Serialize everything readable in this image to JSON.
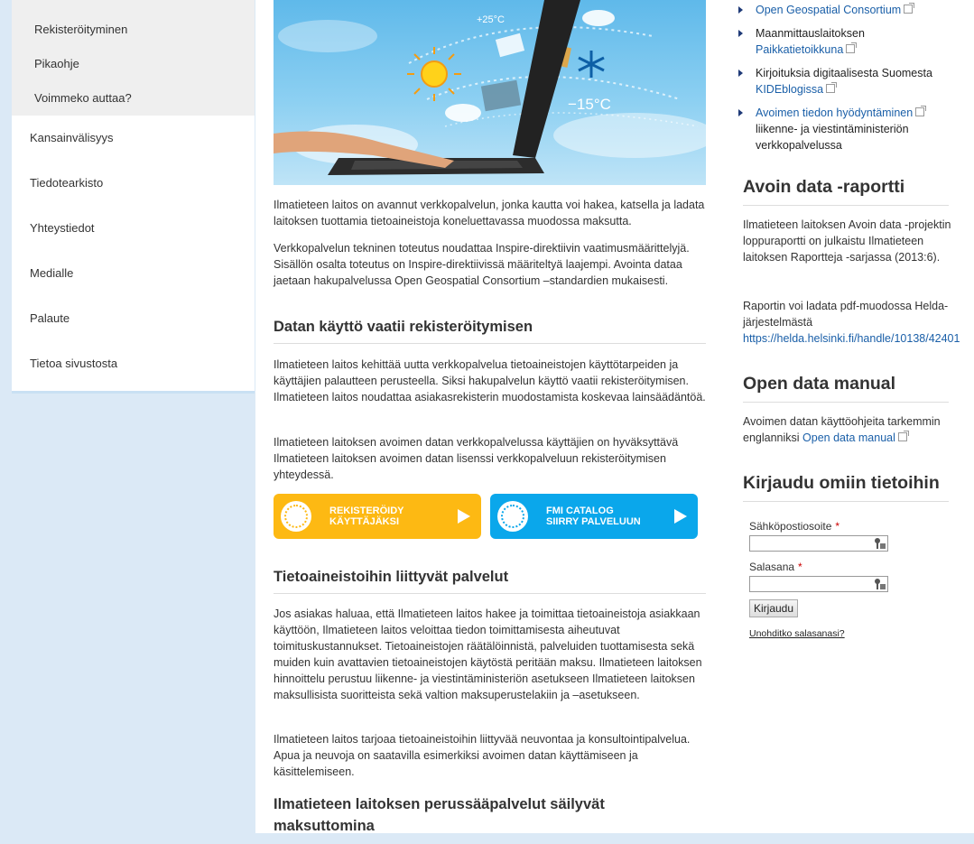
{
  "left_nav": {
    "sub_items": [
      "Rekisteröityminen",
      "Pikaohje",
      "Voimmeko auttaa?"
    ],
    "main_items": [
      "Kansainvälisyys",
      "Tiedotearkisto",
      "Yhteystiedot",
      "Medialle",
      "Palaute",
      "Tietoa sivustosta"
    ]
  },
  "hero": {
    "temp_warm": "+25°C",
    "temp_cold": "−15°C"
  },
  "center": {
    "intro_p1": "Ilmatieteen laitos on avannut verkkopalvelun, jonka kautta voi hakea, katsella ja ladata laitoksen tuottamia tietoaineistoja koneluettavassa muodossa maksutta.",
    "intro_p2": "Verkkopalvelun tekninen toteutus noudattaa Inspire-direktiivin vaatimusmäärittelyjä. Sisällön osalta toteutus on Inspire-direktiivissä määriteltyä laajempi. Avointa dataa jaetaan hakupalvelussa Open Geospatial Consortium –standardien mukaisesti.",
    "h_registration": "Datan käyttö vaatii rekisteröitymisen",
    "reg_p1": "Ilmatieteen laitos kehittää uutta verkkopalvelua tietoaineistojen käyttötarpeiden ja käyttäjien palautteen perusteella. Siksi hakupalvelun käyttö vaatii rekisteröitymisen. Ilmatieteen laitos noudattaa asiakasrekisterin muodostamista koskevaa lainsäädäntöä.",
    "reg_p2": "Ilmatieteen laitoksen avoimen datan verkkopalvelussa käyttäjien on hyväksyttävä Ilmatieteen laitoksen avoimen datan lisenssi verkkopalveluun rekisteröitymisen yhteydessä.",
    "cta_register_line1": "REKISTERÖIDY",
    "cta_register_line2": "KÄYTTÄJÄKSI",
    "cta_catalog_line1": "FMI CATALOG",
    "cta_catalog_line2": "SIIRRY PALVELUUN",
    "h_services": "Tietoaineistoihin liittyvät palvelut",
    "services_p1": "Jos asiakas haluaa, että Ilmatieteen laitos hakee ja toimittaa tietoaineistoja asiakkaan käyttöön, Ilmatieteen laitos veloittaa tiedon toimittamisesta aiheutuvat toimituskustannukset. Tietoaineistojen räätälöinnistä, palveluiden tuottamisesta sekä muiden kuin avattavien tietoaineistojen käytöstä peritään maksu.  Ilmatieteen laitoksen hinnoittelu perustuu liikenne- ja viestintäministeriön asetukseen Ilmatieteen laitoksen maksullisista suoritteista sekä valtion maksuperustelakiin ja –asetukseen.",
    "services_p2": "Ilmatieteen laitos tarjoaa tietoaineistoihin liittyvää neuvontaa ja konsultointipalvelua. Apua ja neuvoja on saatavilla esimerkiksi avoimen datan käyttämiseen ja käsittelemiseen.",
    "h_basic": "Ilmatieteen laitoksen perussääpalvelut säilyvät maksuttomina"
  },
  "right": {
    "links": [
      {
        "plain": "",
        "link": "Open Geospatial Consortium",
        "tail": ""
      },
      {
        "plain": "Maanmittauslaitoksen",
        "link": "Paikkatietoikkuna",
        "tail": ""
      },
      {
        "plain": "Kirjoituksia digitaalisesta Suomesta",
        "link": "KIDEblogissa",
        "tail": ""
      },
      {
        "plain": "",
        "link": "Avoimen tiedon hyödyntäminen",
        "tail": "liikenne- ja viestintäministeriön verkkopalvelussa"
      }
    ],
    "h_report": "Avoin data -raportti",
    "report_p1": "Ilmatieteen laitoksen Avoin data -projektin loppuraportti on julkaistu Ilmatieteen laitoksen Raportteja -sarjassa (2013:6).",
    "report_p2": "Raportin voi ladata pdf-muodossa Helda-järjestelmästä",
    "report_url": "https://helda.helsinki.fi/handle/10138/42401",
    "h_manual": "Open data manual",
    "manual_text": "Avoimen datan käyttöohjeita tarkemmin englanniksi",
    "manual_link": "Open data manual",
    "h_login": "Kirjaudu omiin tietoihin",
    "email_label": "Sähköpostiosoite",
    "password_label": "Salasana",
    "required_mark": "*",
    "login_button": "Kirjaudu",
    "forgot_link": "Unohditko salasanasi?"
  },
  "colors": {
    "register_cta": "#fdb913",
    "catalog_cta": "#0aa7eb",
    "link": "#1a5fa8",
    "page_bg": "#dbe9f6"
  }
}
